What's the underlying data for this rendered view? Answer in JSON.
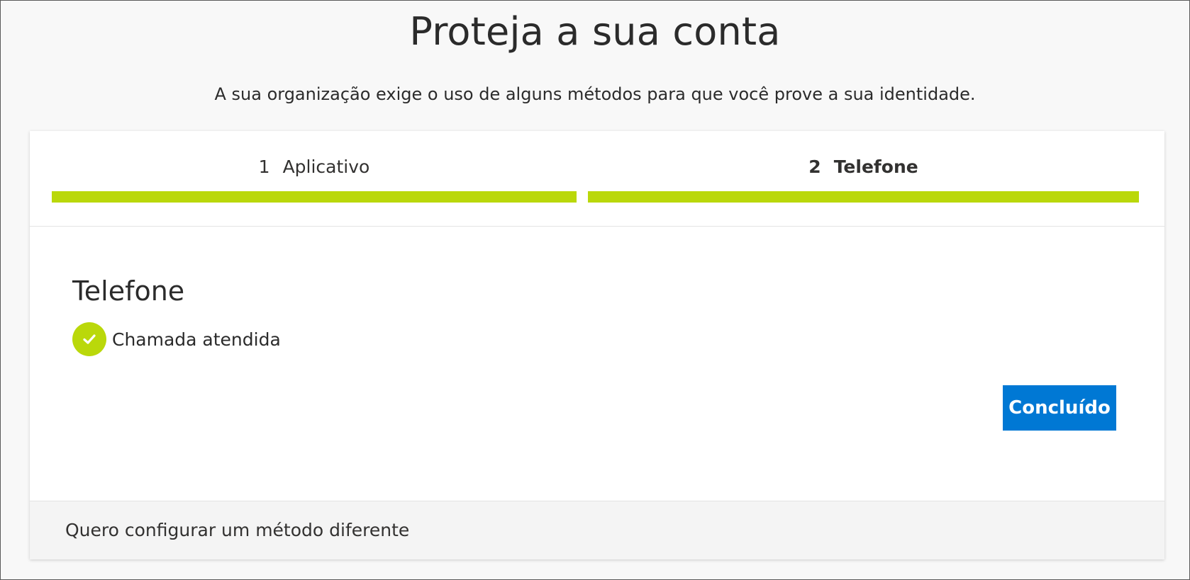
{
  "header": {
    "title": "Proteja a sua conta",
    "subtitle": "A sua organização exige o uso de alguns métodos para que você prove a sua identidade."
  },
  "steps": [
    {
      "number": "1",
      "label": "Aplicativo",
      "active": false,
      "completed": true
    },
    {
      "number": "2",
      "label": "Telefone",
      "active": true,
      "completed": true
    }
  ],
  "main": {
    "section_title": "Telefone",
    "status_icon": "checkmark-circle-icon",
    "status_text": "Chamada atendida",
    "done_button_label": "Concluído"
  },
  "footer": {
    "link_text": "Quero configurar um método diferente"
  },
  "colors": {
    "progress_bar": "#bad80a",
    "success_icon": "#bad80a",
    "primary_button": "#0078d4",
    "background": "#f8f8f8"
  }
}
